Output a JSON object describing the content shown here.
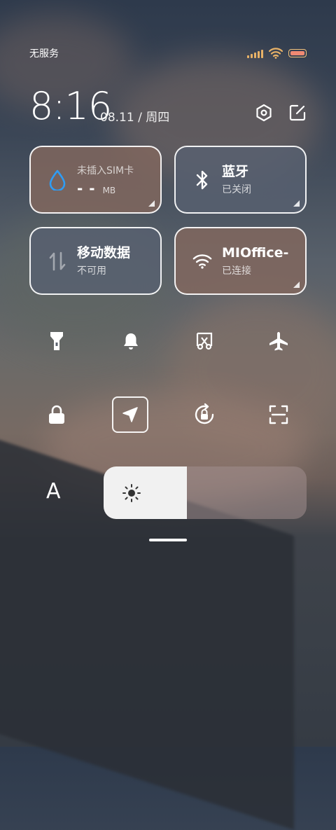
{
  "status": {
    "carrier": "无服务"
  },
  "clock": {
    "time": "8:16",
    "date": "08.11 / 周四"
  },
  "tiles": {
    "data": {
      "title": "未插入SIM卡",
      "value": "- -",
      "unit": "MB"
    },
    "bluetooth": {
      "title": "蓝牙",
      "status": "已关闭"
    },
    "mobile_data": {
      "title": "移动数据",
      "status": "不可用"
    },
    "wifi": {
      "title": "MIOffice-",
      "status": "已连接"
    }
  },
  "toggles": [
    "flashlight",
    "mute",
    "screenshot",
    "airplane-mode",
    "lock-screen",
    "location",
    "auto-rotate",
    "scanner"
  ],
  "font_button": {
    "label": "A"
  },
  "brightness": {
    "level": 0.41
  },
  "colors": {
    "accent_blue": "#2f9cf3",
    "tile_brown": "#82685e",
    "tile_slate": "#586070",
    "battery": "#f08a73"
  }
}
